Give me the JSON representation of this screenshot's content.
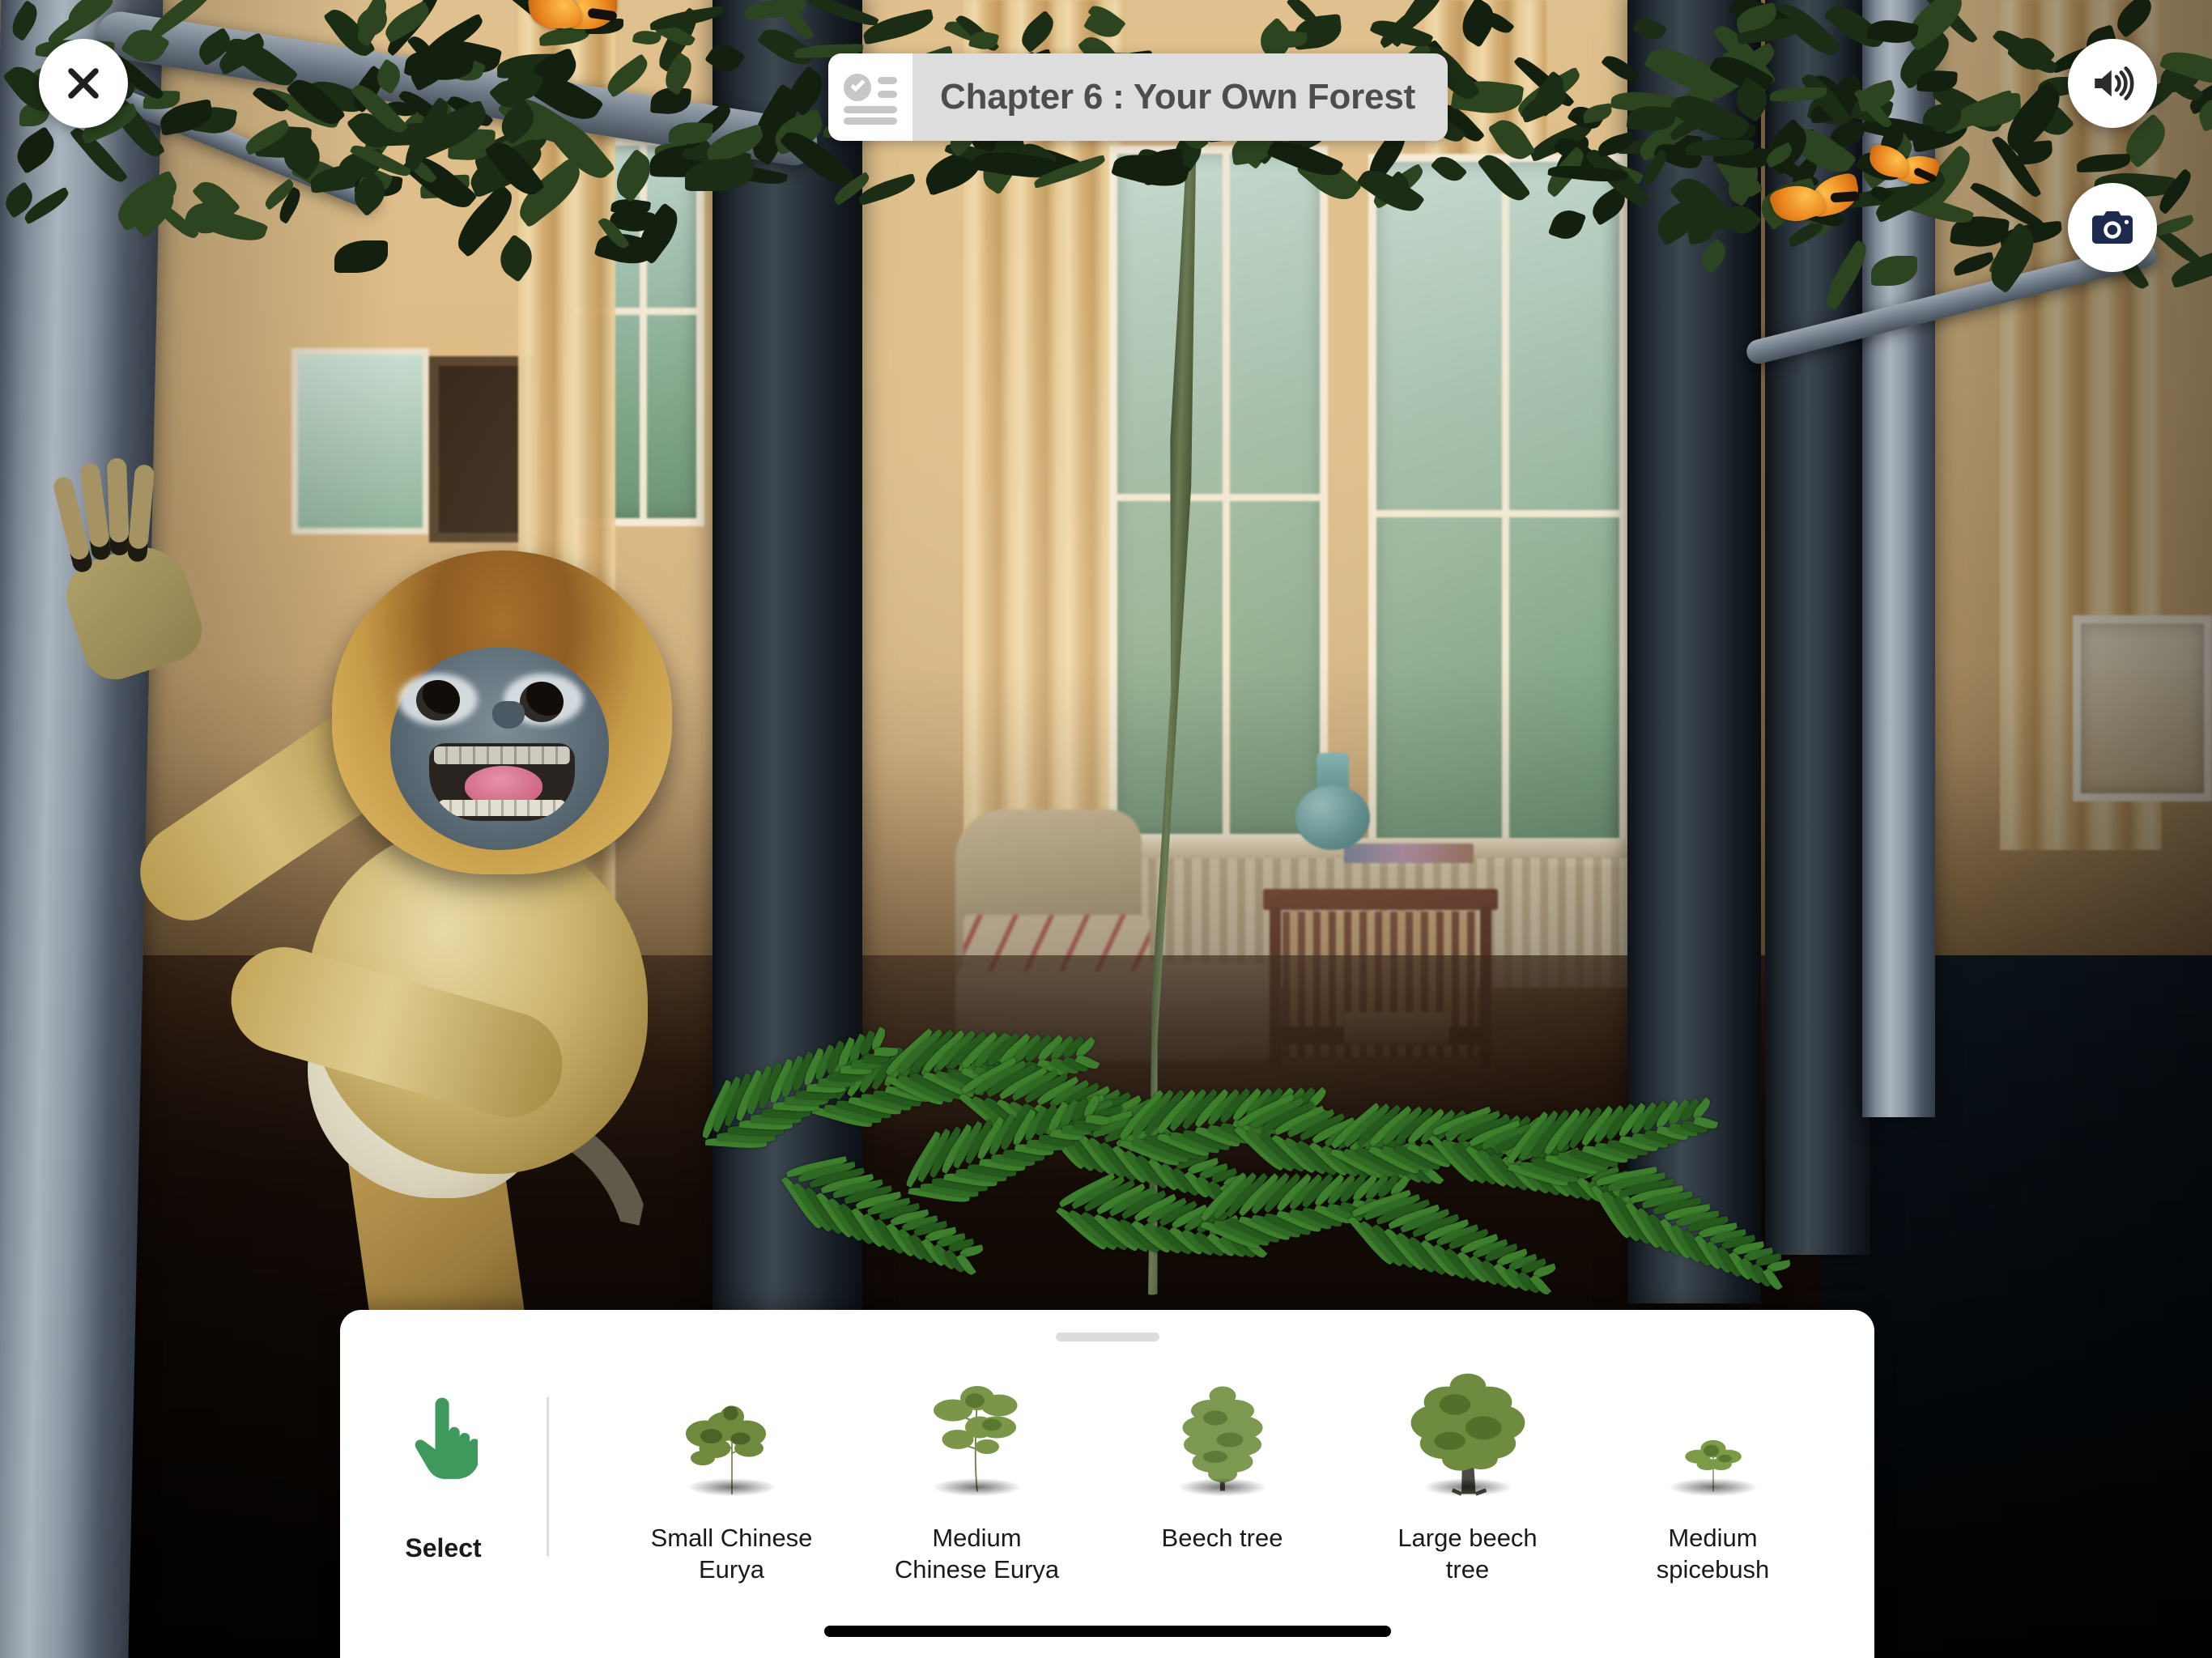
{
  "app": {
    "title": "Chapter 6 : Your Own Forest",
    "scene_description": "Augmented reality forest overlaid on a living room; a golden snub-nosed monkey clings to a birch trunk"
  },
  "header": {
    "title": "Chapter 6 : Your Own Forest",
    "icon": "checklist-icon",
    "close_icon": "close-icon",
    "sound_icon": "speaker-volume-icon",
    "camera_icon": "camera-icon",
    "colors": {
      "title_bg": "#dddddd",
      "title_icon_bg": "#ffffff",
      "title_text": "#4d4d4d",
      "button_bg": "#ffffff",
      "close_glyph": "#1f1f1f",
      "sound_glyph": "#2b2b2b",
      "camera_glyph": "#1d2a4d"
    }
  },
  "bottom_sheet": {
    "grab_handle": "drag-handle",
    "tool": {
      "icon": "pointing-hand-icon",
      "label": "Select",
      "color": "#3d9a5c",
      "active": true
    },
    "plants": [
      {
        "label": "Small Chinese Eurya",
        "icon": "shrub-icon",
        "size": "small"
      },
      {
        "label": "Medium Chinese Eurya",
        "icon": "sapling-icon",
        "size": "medium"
      },
      {
        "label": "Beech tree",
        "icon": "beech-tree-icon",
        "size": "tall"
      },
      {
        "label": "Large beech tree",
        "icon": "large-tree-icon",
        "size": "large"
      },
      {
        "label": "Medium spicebush",
        "icon": "bush-icon",
        "size": "small"
      }
    ],
    "home_indicator": "home-indicator",
    "colors": {
      "sheet_bg": "#ffffff",
      "handle": "#dcdcdc",
      "divider": "#dcdcdc",
      "label_text": "#1a1a1a",
      "home_bar": "#000000"
    }
  }
}
